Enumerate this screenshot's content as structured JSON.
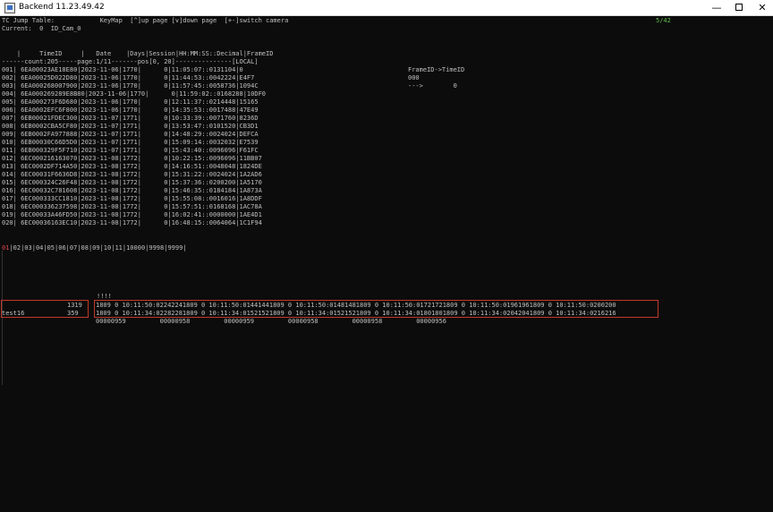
{
  "window": {
    "title": "Backend 11.23.49.42",
    "min_glyph": "—",
    "close_glyph": "✕"
  },
  "console": {
    "header_line": "TC Jump Table:            KeyMap  [^]up page [v]down page  [+-]switch camera",
    "page_counter": "5/42",
    "current_line": "Current:  0  ID_Cam_0",
    "columns_line": "    |     TimeID     |   Date    |Days|Session|HH:MM:SS::Decimal|FrameID",
    "summary_line": "------count:205-----page:1/11-------pos[0, 20]---------------[LOCAL]",
    "rows": [
      "001| 6EA00023AE18E80|2023-11-06|1770|      0|11:05:07::0131104|0",
      "002| 6EA00025D022D80|2023-11-06|1770|      0|11:44:53::0042224|E4F7",
      "003| 6EA000268007900|2023-11-06|1770|      0|11:57:45::0058736|1094C",
      "004| 6EA000269289E8B80|2023-11-06|1770|      0|11:59:02::0168288|10DF0",
      "005| 6EA000273F6D680|2023-11-06|1770|      0|12:11:37::0214448|15165",
      "006| 6EA0002EFC6F800|2023-11-06|1770|      0|14:35:53::0017488|47E49",
      "007| 6EB00021FDEC300|2023-11-07|1771|      0|10:33:39::0071760|8236D",
      "008| 6EB0002CBA5CF80|2023-11-07|1771|      0|13:53:47::0101520|CB3D1",
      "009| 6EB0002FA977888|2023-11-07|1771|      0|14:48:29::0024024|DEFCA",
      "010| 6EB00030C66D5D0|2023-11-07|1771|      0|15:09:14::0032032|E7539",
      "011| 6EB000329F5F710|2023-11-07|1771|      0|15:43:40::0096096|F61FC",
      "012| 6EC000216163070|2023-11-08|1772|      0|10:22:15::0096096|11BB07",
      "013| 6EC0002DF714A50|2023-11-08|1772|      0|14:16:51::0048048|1824DE",
      "014| 6EC00031F6636D8|2023-11-08|1772|      0|15:31:22::0024024|1A2AD6",
      "015| 6EC000324C26F48|2023-11-08|1772|      0|15:37:36::0200200|1A5170",
      "016| 6EC00032C781608|2023-11-08|1772|      0|15:46:35::0184184|1A873A",
      "017| 6EC000333CC1810|2023-11-08|1772|      0|15:55:08::0016016|1A8DDF",
      "018| 6EC000336237598|2023-11-08|1772|      0|15:57:51::0168168|1AC78A",
      "019| 6EC00033A46FD50|2023-11-08|1772|      0|16:02:41::0000000|1AE4D1",
      "020| 6EC00036163EC10|2023-11-08|1772|      0|16:48:15::0064064|1C1F94"
    ],
    "side_panel": {
      "label": "FrameID->TimeID",
      "value": "000",
      "arrow_line": "--->        0"
    },
    "pages_first": "01",
    "pages_rest": "|02|03|04|05|06|07|08|09|10|11|10000|9998|9999|",
    "marker": "!!!!",
    "stream_rows": [
      {
        "label": "",
        "count": "1319",
        "data": "1809 0 10:11:50:02242241809 0 10:11:50:01441441809 0 10:11:50:01481481809 0 10:11:50:01721721809 0 10:11:50:01961961809 0 10:11:50:0200200"
      },
      {
        "label": "test16",
        "count": "359",
        "data": "1809 0 10:11:34:02282281809 0 10:11:34:01521521809 0 10:11:34:01521521809 0 10:11:34:01801801809 0 10:11:34:02042041809 0 10:11:34:0216216"
      }
    ],
    "stream_footer": "00000959         00000958         00000959         00000958         00000958         00000956"
  }
}
